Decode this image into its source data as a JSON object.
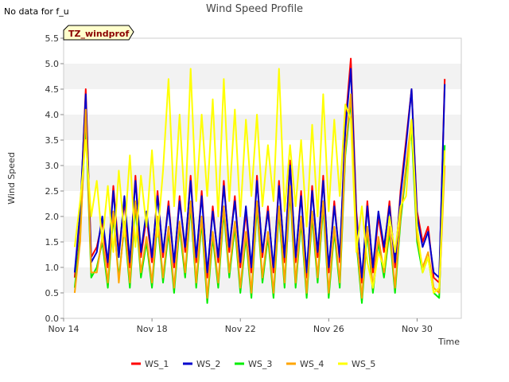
{
  "note": "No data for f_u",
  "chart_data": {
    "type": "line",
    "title": "Wind Speed Profile",
    "xlabel": "Time",
    "ylabel": "Wind Speed",
    "badge": "TZ_windprof",
    "x_axis": "date",
    "xlim": [
      "2024-11-14",
      "2024-12-02"
    ],
    "xticks": [
      "Nov 14",
      "Nov 18",
      "Nov 22",
      "Nov 26",
      "Nov 30"
    ],
    "ylim": [
      0.0,
      5.5
    ],
    "yticks": [
      "0.0",
      "0.5",
      "1.0",
      "1.5",
      "2.0",
      "2.5",
      "3.0",
      "3.5",
      "4.0",
      "4.5",
      "5.0",
      "5.5"
    ],
    "grid": "horizontal bands",
    "legend_position": "bottom",
    "x": [
      "2024-11-14T12:00",
      "2024-11-14T18:00",
      "2024-11-15T00:00",
      "2024-11-15T06:00",
      "2024-11-15T12:00",
      "2024-11-15T18:00",
      "2024-11-16T00:00",
      "2024-11-16T06:00",
      "2024-11-16T12:00",
      "2024-11-16T18:00",
      "2024-11-17T00:00",
      "2024-11-17T06:00",
      "2024-11-17T12:00",
      "2024-11-17T18:00",
      "2024-11-18T00:00",
      "2024-11-18T06:00",
      "2024-11-18T12:00",
      "2024-11-18T18:00",
      "2024-11-19T00:00",
      "2024-11-19T06:00",
      "2024-11-19T12:00",
      "2024-11-19T18:00",
      "2024-11-20T00:00",
      "2024-11-20T06:00",
      "2024-11-20T12:00",
      "2024-11-20T18:00",
      "2024-11-21T00:00",
      "2024-11-21T06:00",
      "2024-11-21T12:00",
      "2024-11-21T18:00",
      "2024-11-22T00:00",
      "2024-11-22T06:00",
      "2024-11-22T12:00",
      "2024-11-22T18:00",
      "2024-11-23T00:00",
      "2024-11-23T06:00",
      "2024-11-23T12:00",
      "2024-11-23T18:00",
      "2024-11-24T00:00",
      "2024-11-24T06:00",
      "2024-11-24T12:00",
      "2024-11-24T18:00",
      "2024-11-25T00:00",
      "2024-11-25T06:00",
      "2024-11-25T12:00",
      "2024-11-25T18:00",
      "2024-11-26T00:00",
      "2024-11-26T06:00",
      "2024-11-26T12:00",
      "2024-11-26T18:00",
      "2024-11-27T00:00",
      "2024-11-27T06:00",
      "2024-11-27T12:00",
      "2024-11-27T18:00",
      "2024-11-28T00:00",
      "2024-11-28T06:00",
      "2024-11-28T12:00",
      "2024-11-28T18:00",
      "2024-11-29T00:00",
      "2024-11-29T06:00",
      "2024-11-29T12:00",
      "2024-11-29T18:00",
      "2024-11-30T00:00",
      "2024-11-30T06:00",
      "2024-11-30T12:00",
      "2024-11-30T18:00",
      "2024-12-01T00:00",
      "2024-12-01T06:00"
    ],
    "series": [
      {
        "name": "WS_1",
        "color": "#ff0000",
        "values": [
          0.8,
          2.0,
          4.5,
          1.2,
          1.4,
          1.9,
          1.0,
          2.6,
          1.3,
          2.3,
          1.0,
          2.8,
          1.2,
          2.0,
          1.1,
          2.5,
          1.2,
          2.3,
          1.0,
          2.4,
          1.3,
          2.8,
          1.1,
          2.5,
          0.8,
          2.2,
          1.1,
          2.7,
          1.3,
          2.4,
          1.0,
          2.1,
          0.9,
          2.8,
          1.2,
          2.2,
          0.9,
          2.7,
          1.1,
          3.1,
          1.1,
          2.5,
          0.8,
          2.6,
          1.2,
          2.8,
          0.9,
          2.3,
          1.1,
          3.8,
          5.1,
          2.1,
          0.7,
          2.3,
          0.9,
          2.0,
          1.3,
          2.3,
          1.0,
          2.5,
          3.5,
          4.5,
          2.1,
          1.5,
          1.8,
          0.8,
          0.7,
          4.7
        ]
      },
      {
        "name": "WS_2",
        "color": "#0000cc",
        "values": [
          0.9,
          2.1,
          4.4,
          1.1,
          1.3,
          2.0,
          1.1,
          2.5,
          1.2,
          2.4,
          1.1,
          2.7,
          1.3,
          2.1,
          1.2,
          2.4,
          1.3,
          2.2,
          1.1,
          2.3,
          1.4,
          2.7,
          1.2,
          2.4,
          0.9,
          2.1,
          1.2,
          2.6,
          1.4,
          2.3,
          1.1,
          2.2,
          1.0,
          2.7,
          1.3,
          2.1,
          1.0,
          2.6,
          1.2,
          3.0,
          1.2,
          2.4,
          0.9,
          2.5,
          1.3,
          2.7,
          1.0,
          2.2,
          1.2,
          3.7,
          4.9,
          2.0,
          0.8,
          2.2,
          1.0,
          2.1,
          1.4,
          2.2,
          1.1,
          2.4,
          3.4,
          4.5,
          2.0,
          1.4,
          1.7,
          0.9,
          0.8,
          4.6
        ]
      },
      {
        "name": "WS_3",
        "color": "#00ee00",
        "values": [
          0.6,
          1.6,
          3.9,
          0.8,
          1.0,
          1.5,
          0.6,
          2.0,
          0.8,
          1.8,
          0.6,
          2.2,
          0.8,
          1.5,
          0.6,
          1.9,
          0.7,
          1.7,
          0.5,
          1.8,
          0.8,
          2.2,
          0.6,
          1.9,
          0.3,
          1.6,
          0.6,
          2.1,
          0.8,
          1.8,
          0.5,
          1.6,
          0.4,
          2.2,
          0.7,
          1.6,
          0.4,
          2.1,
          0.6,
          2.5,
          0.6,
          1.9,
          0.4,
          2.0,
          0.7,
          2.2,
          0.4,
          1.7,
          0.6,
          3.2,
          4.3,
          1.5,
          0.3,
          1.7,
          0.5,
          1.5,
          0.8,
          1.7,
          0.5,
          1.9,
          2.9,
          3.7,
          1.5,
          0.9,
          1.2,
          0.5,
          0.4,
          3.4
        ]
      },
      {
        "name": "WS_4",
        "color": "#ffa500",
        "values": [
          0.5,
          1.5,
          4.1,
          0.9,
          0.9,
          1.6,
          0.7,
          2.1,
          0.7,
          1.9,
          0.7,
          2.3,
          0.9,
          1.6,
          0.7,
          2.0,
          0.8,
          1.8,
          0.6,
          1.9,
          0.9,
          2.3,
          0.7,
          2.0,
          0.4,
          1.7,
          0.7,
          2.2,
          0.9,
          1.9,
          0.6,
          1.7,
          0.5,
          2.3,
          0.8,
          1.7,
          0.5,
          2.2,
          0.7,
          2.6,
          0.7,
          2.0,
          0.5,
          2.1,
          0.8,
          2.3,
          0.5,
          1.8,
          0.7,
          3.3,
          4.4,
          1.6,
          0.4,
          1.8,
          0.6,
          1.6,
          0.9,
          1.8,
          0.6,
          2.0,
          3.0,
          3.9,
          1.6,
          1.0,
          1.3,
          0.6,
          0.5,
          3.0
        ]
      },
      {
        "name": "WS_5",
        "color": "#ffff00",
        "values": [
          1.4,
          2.3,
          3.5,
          2.0,
          2.7,
          1.5,
          2.6,
          1.3,
          2.9,
          1.6,
          3.2,
          1.4,
          2.8,
          1.8,
          3.3,
          1.6,
          2.9,
          4.7,
          2.2,
          4.0,
          2.1,
          4.9,
          2.3,
          4.0,
          2.4,
          4.3,
          2.0,
          4.7,
          2.3,
          4.1,
          2.0,
          3.9,
          2.4,
          4.0,
          2.2,
          3.4,
          2.3,
          4.9,
          2.1,
          3.4,
          2.2,
          3.5,
          1.8,
          3.8,
          2.0,
          4.4,
          2.1,
          3.9,
          2.4,
          4.2,
          3.9,
          1.3,
          2.2,
          1.1,
          0.6,
          1.3,
          1.0,
          2.0,
          1.3,
          2.2,
          2.4,
          3.9,
          1.8,
          0.9,
          1.2,
          0.5,
          0.6,
          3.3
        ]
      }
    ]
  }
}
